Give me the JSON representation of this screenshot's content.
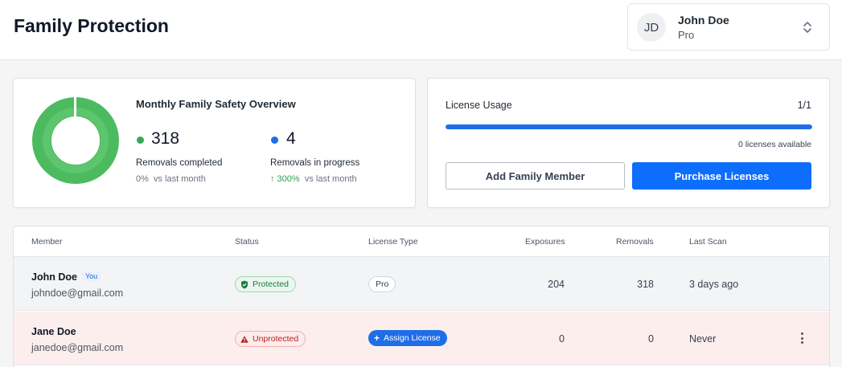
{
  "header": {
    "title": "Family Protection",
    "account": {
      "initials": "JD",
      "name": "John Doe",
      "plan": "Pro",
      "icon": "chevron-up-down-icon"
    }
  },
  "overview": {
    "title": "Monthly Family Safety Overview",
    "donut_colors": {
      "outer": "#4cbb5f",
      "inner": "#5cc56d",
      "gap": "#ffffff"
    },
    "completed": {
      "value": "318",
      "label": "Removals completed",
      "change": "0%",
      "change_suffix": "vs last month",
      "dot_color": "#3aa755"
    },
    "in_progress": {
      "value": "4",
      "label": "Removals in progress",
      "change": "↑ 300%",
      "change_suffix": "vs last month",
      "dot_color": "#1f6ee8"
    }
  },
  "license": {
    "label": "License Usage",
    "count": "1/1",
    "usage_fraction": 1.0,
    "available": "0 licenses available",
    "add_button": "Add Family Member",
    "purchase_button": "Purchase Licenses"
  },
  "table": {
    "columns": [
      "Member",
      "Status",
      "License Type",
      "Exposures",
      "Removals",
      "Last Scan"
    ],
    "rows": [
      {
        "name": "John Doe",
        "tag": "You",
        "email": "johndoe@gmail.com",
        "status": "Protected",
        "status_icon": "shield-check-icon",
        "license": "Pro",
        "exposures": "204",
        "removals": "318",
        "last_scan": "3 days ago"
      },
      {
        "name": "Jane Doe",
        "tag": "",
        "email": "janedoe@gmail.com",
        "status": "Unprotected",
        "status_icon": "warning-triangle-icon",
        "license": "Assign License",
        "license_icon": "plus-icon",
        "exposures": "0",
        "removals": "0",
        "last_scan": "Never",
        "menu_icon": "more-vertical-icon"
      }
    ]
  }
}
